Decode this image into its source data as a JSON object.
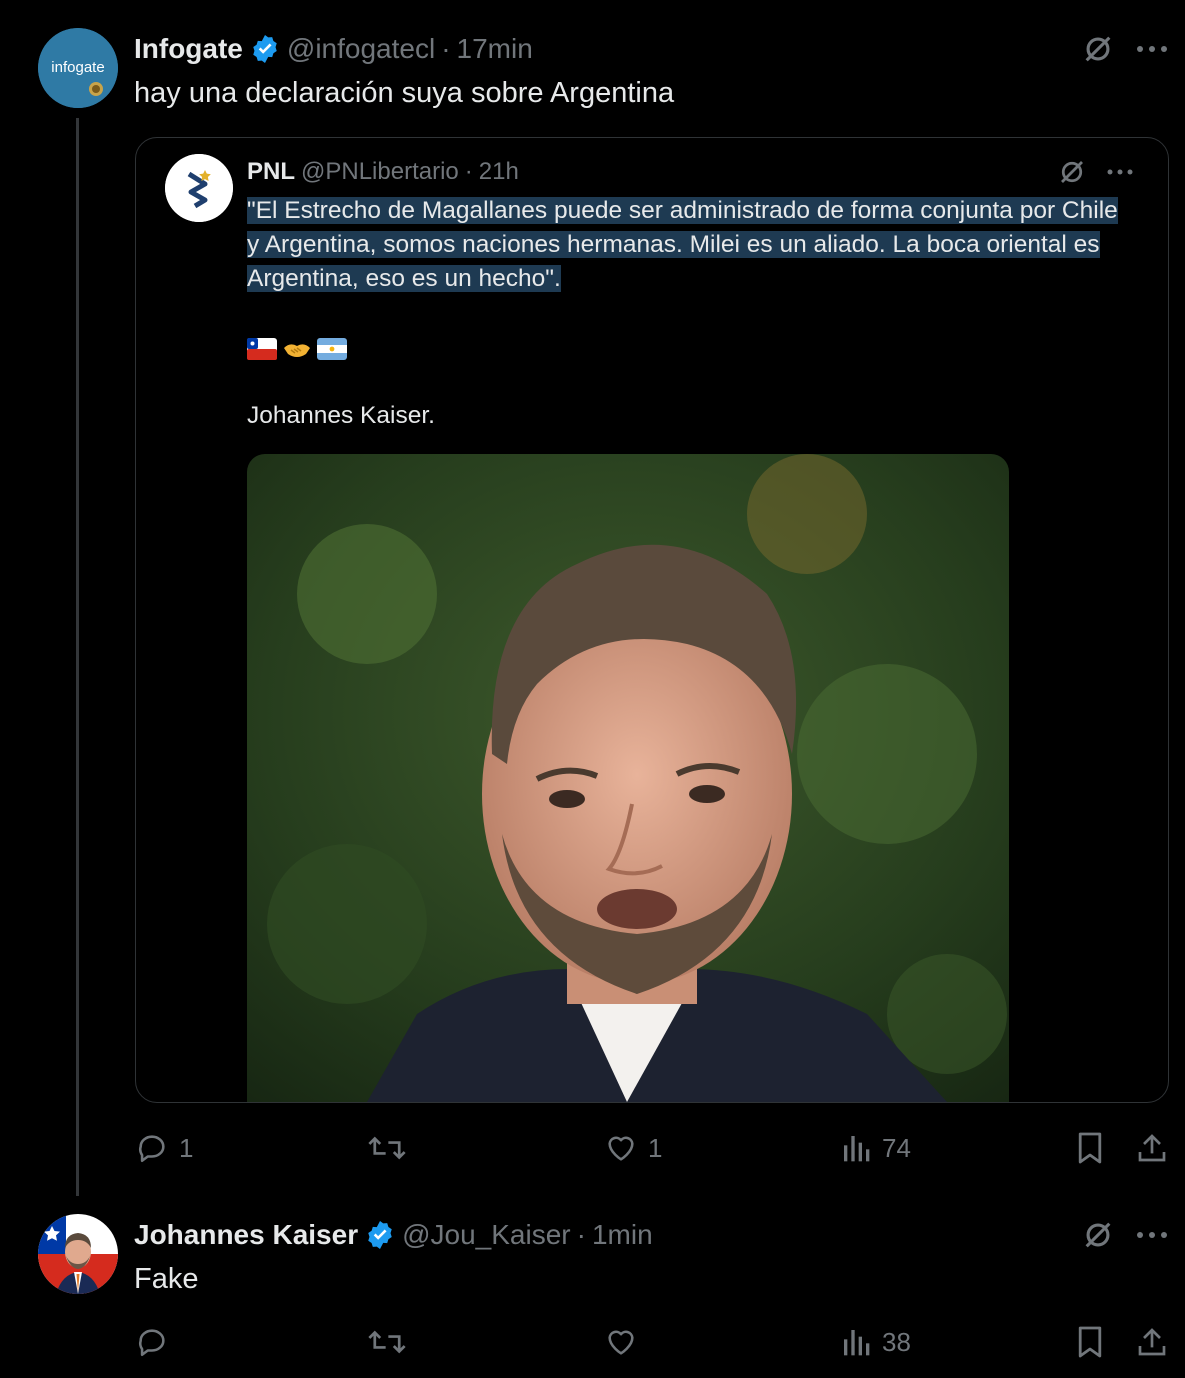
{
  "tweet1": {
    "author_name": "Infogate",
    "handle": "@infogatecl",
    "sep": "·",
    "time": "17min",
    "text": "hay una declaración suya sobre Argentina",
    "avatar_text": "infogate",
    "avatar_icon": "infogate-logo",
    "actions": {
      "reply_count": "1",
      "retweet_count": "",
      "like_count": "1",
      "views_count": "74"
    }
  },
  "quote": {
    "author_name": "PNL",
    "handle": "@PNLibertario",
    "sep": "·",
    "time": "21h",
    "text_highlighted": "\"El Estrecho de Magallanes puede ser administrado de forma conjunta por Chile y Argentina, somos naciones hermanas. Milei es un aliado. La boca oriental es Argentina, eso es un hecho\".",
    "emojis": [
      "chile-flag",
      "handshake",
      "argentina-flag"
    ],
    "signature": "Johannes Kaiser.",
    "avatar_icon": "pnl-logo"
  },
  "tweet2": {
    "author_name": "Johannes Kaiser",
    "handle": "@Jou_Kaiser",
    "sep": "·",
    "time": "1min",
    "text": "Fake",
    "actions": {
      "reply_count": "",
      "retweet_count": "",
      "like_count": "",
      "views_count": "38"
    }
  },
  "colors": {
    "background": "#000000",
    "text": "#e7e9ea",
    "muted": "#71767b",
    "verified": "#1d9bf0",
    "highlight": "#1e3a52",
    "border": "#2f3336"
  }
}
